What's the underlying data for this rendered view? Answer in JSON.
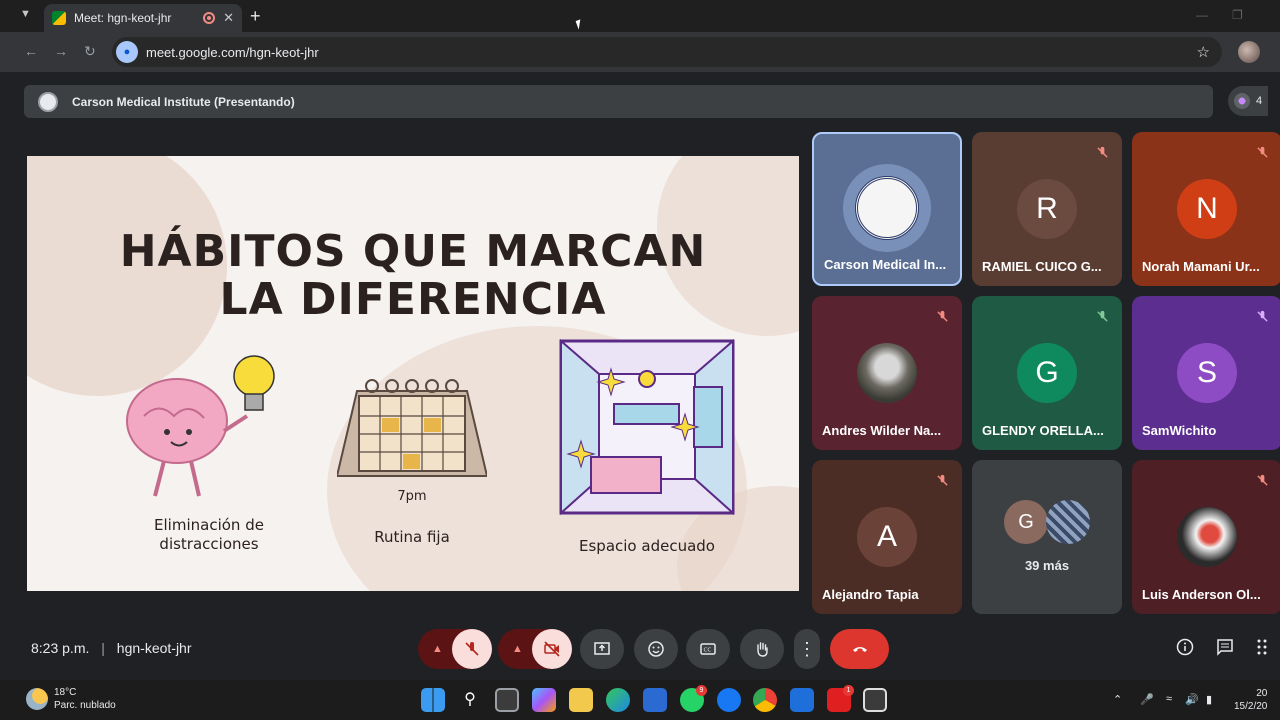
{
  "browser": {
    "tab_title": "Meet: hgn-keot-jhr",
    "url": "meet.google.com/hgn-keot-jhr"
  },
  "presentation_bar": {
    "label": "Carson Medical Institute (Presentando)",
    "participant_count": "4"
  },
  "slide": {
    "title_line1": "HÁBITOS QUE MARCAN",
    "title_line2": "LA DIFERENCIA",
    "item1": "Eliminación de distracciones",
    "item2_time": "7pm",
    "item2": "Rutina fija",
    "item3": "Espacio adecuado"
  },
  "participants": [
    {
      "name": "Carson Medical In...",
      "initial": "",
      "bg": "#5b6f95",
      "muted": false
    },
    {
      "name": "RAMIEL CUICO G...",
      "initial": "R",
      "bg": "#5a3d32",
      "muted": true
    },
    {
      "name": "Norah Mamani Ur...",
      "initial": "N",
      "bg": "#8b3318",
      "muted": true
    },
    {
      "name": "Andres Wilder Na...",
      "initial": "",
      "bg": "#5a2330",
      "muted": true
    },
    {
      "name": "GLENDY ORELLA...",
      "initial": "G",
      "bg": "#1f5a45",
      "muted": true
    },
    {
      "name": "SamWichito",
      "initial": "S",
      "bg": "#5b2e8f",
      "muted": true
    },
    {
      "name": "Alejandro Tapia",
      "initial": "A",
      "bg": "#4c2d26",
      "muted": true
    },
    {
      "name": "39 más",
      "initial": "G",
      "bg": "#3c4043",
      "muted": false
    },
    {
      "name": "Luis Anderson Ol...",
      "initial": "",
      "bg": "#4e1f24",
      "muted": true
    }
  ],
  "footer": {
    "time": "8:23 p.m.",
    "separator": "|",
    "meeting_code": "hgn-keot-jhr"
  },
  "taskbar": {
    "temp": "18°C",
    "weather": "Parc. nublado",
    "time": "20",
    "date": "15/2/20"
  }
}
